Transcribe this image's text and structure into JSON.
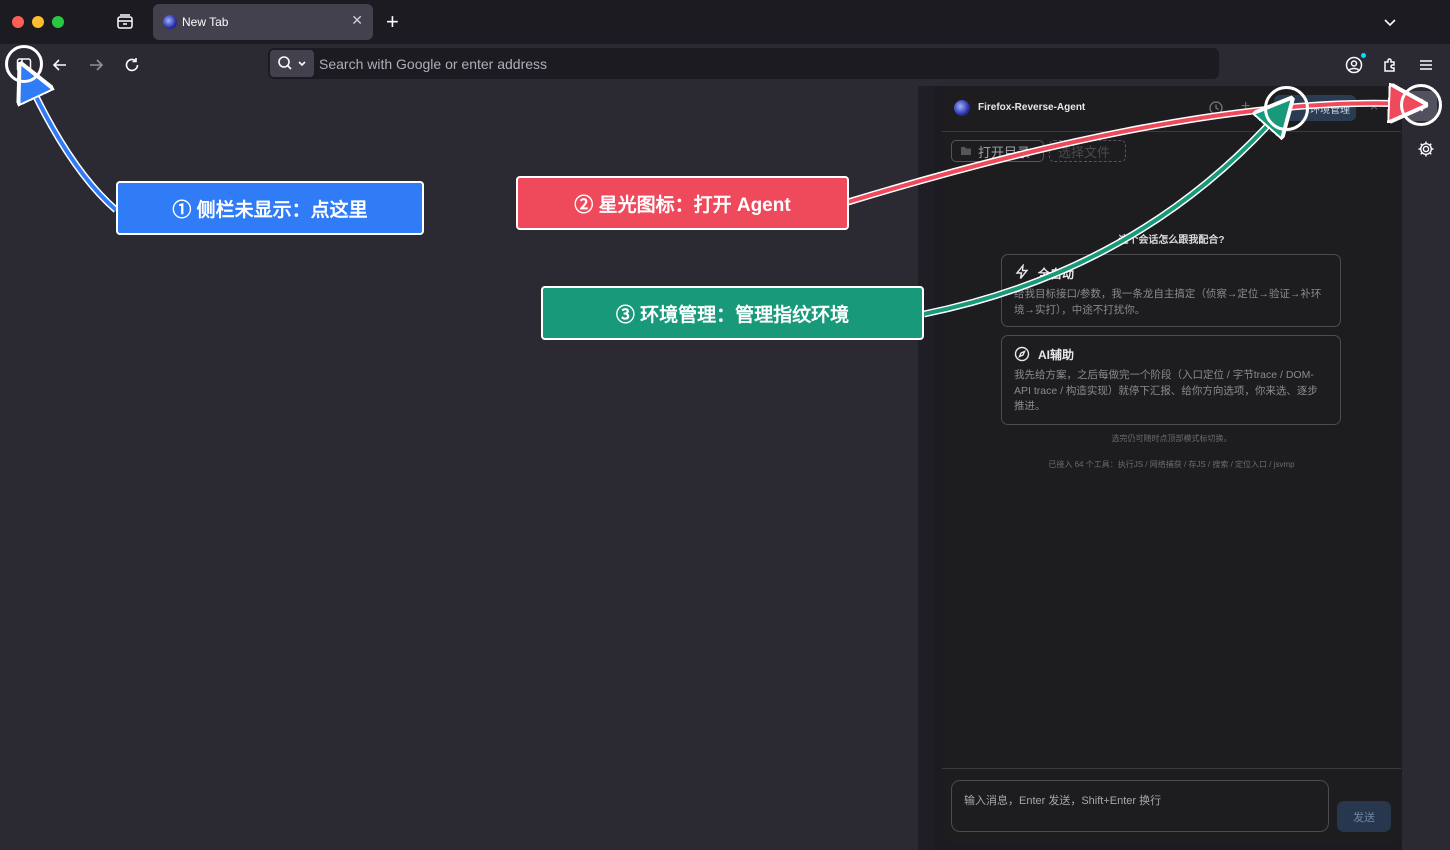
{
  "tab": {
    "title": "New Tab",
    "close": "✕",
    "new_tab": "+"
  },
  "urlbar": {
    "placeholder": "Search with Google or enter address"
  },
  "panel": {
    "title": "Firefox-Reverse-Agent",
    "env_button": "环境管理",
    "open_dir": "打开目录",
    "select_chip": "选择文件",
    "question": "这个会话怎么跟我配合?",
    "modes": [
      {
        "title": "全自动",
        "icon": "lightning-icon",
        "desc": "给我目标接口/参数，我一条龙自主搞定（侦察→定位→验证→补环境→实打），中途不打扰你。"
      },
      {
        "title": "AI辅助",
        "icon": "compass-icon",
        "desc": "我先给方案，之后每做完一个阶段（入口定位 / 字节trace / DOM-API trace / 构造实现）就停下汇报、给你方向选项，你来选、逐步推进。"
      }
    ],
    "hint": "选完仍可随时点顶部模式标切换。",
    "tools": "已接入 64 个工具：执行JS / 网络捕获 / 存JS / 搜索 / 定位入口 / jsvmp",
    "input_placeholder": "输入消息，Enter 发送，Shift+Enter 换行",
    "send": "发送"
  },
  "callouts": [
    {
      "label": "① 侧栏未显示：点这里",
      "color": "#2f7cf6"
    },
    {
      "label": "② 星光图标：打开 Agent",
      "color": "#ef4a5c"
    },
    {
      "label": "③ 环境管理：管理指纹环境",
      "color": "#17997a"
    }
  ],
  "colors": {
    "blue": "#2f7cf6",
    "red": "#ef4a5c",
    "green": "#17997a",
    "accent": "#0df"
  }
}
